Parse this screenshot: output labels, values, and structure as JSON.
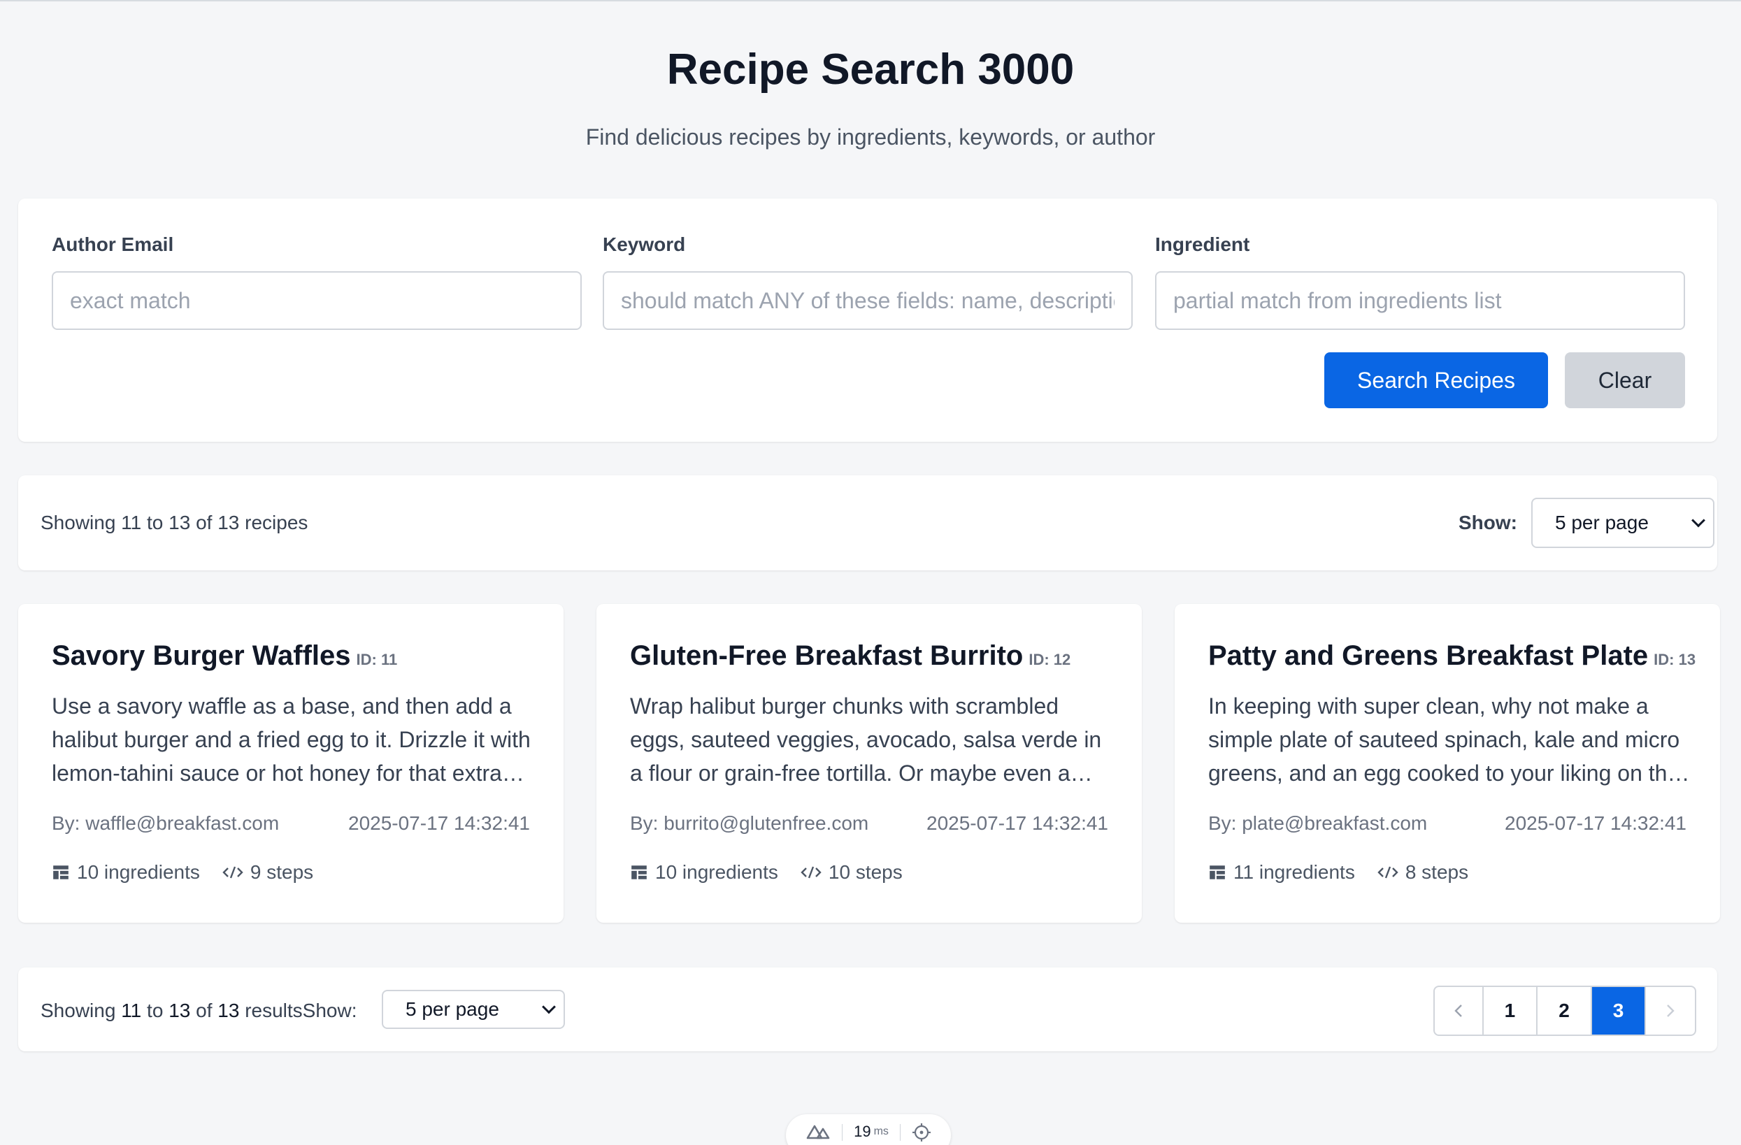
{
  "header": {
    "title": "Recipe Search 3000",
    "subtitle": "Find delicious recipes by ingredients, keywords, or author"
  },
  "search": {
    "author_label": "Author Email",
    "author_placeholder": "exact match",
    "author_value": "",
    "keyword_label": "Keyword",
    "keyword_placeholder": "should match ANY of these fields: name, description",
    "keyword_value": "",
    "ingredient_label": "Ingredient",
    "ingredient_placeholder": "partial match from ingredients list",
    "ingredient_value": "",
    "search_button": "Search Recipes",
    "clear_button": "Clear"
  },
  "summary": {
    "text": "Showing 11 to 13 of 13 recipes",
    "show_label": "Show:",
    "per_page": "5 per page"
  },
  "recipes": [
    {
      "title": "Savory Burger Waffles",
      "id_label": "ID: 11",
      "description": "Use a savory waffle as a base, and then add a halibut burger and a fried egg to it. Drizzle it with lemon-tahini sauce or hot honey for that extra kick.",
      "author": "By: waffle@breakfast.com",
      "date": "2025-07-17 14:32:41",
      "ingredients": "10 ingredients",
      "steps": "9 steps"
    },
    {
      "title": "Gluten-Free Breakfast Burrito",
      "id_label": "ID: 12",
      "description": "Wrap halibut burger chunks with scrambled eggs, sauteed veggies, avocado, salsa verde in a flour or grain-free tortilla. Or maybe even a lettuce wrap.",
      "author": "By: burrito@glutenfree.com",
      "date": "2025-07-17 14:32:41",
      "ingredients": "10 ingredients",
      "steps": "10 steps"
    },
    {
      "title": "Patty and Greens Breakfast Plate",
      "id_label": "ID: 13",
      "description": "In keeping with super clean, why not make a simple plate of sauteed spinach, kale and micro greens, and an egg cooked to your liking on the side.",
      "author": "By: plate@breakfast.com",
      "date": "2025-07-17 14:32:41",
      "ingredients": "11 ingredients",
      "steps": "8 steps"
    }
  ],
  "pager": {
    "summary_prefix": "Showing ",
    "from": "11",
    "to_word": " to ",
    "to": "13",
    "of_word": " of ",
    "total": "13",
    "suffix": " results",
    "show_label": "Show:",
    "per_page": "5 per page",
    "prev_icon": "chevron-left-icon",
    "next_icon": "chevron-right-icon",
    "pages": [
      "1",
      "2",
      "3"
    ],
    "current_page": "3"
  },
  "devtools": {
    "timing": "19",
    "unit": "ms"
  },
  "colors": {
    "accent": "#0a66e4",
    "background": "#f5f6f8",
    "card": "#ffffff",
    "secondary_button": "#d1d5db"
  }
}
